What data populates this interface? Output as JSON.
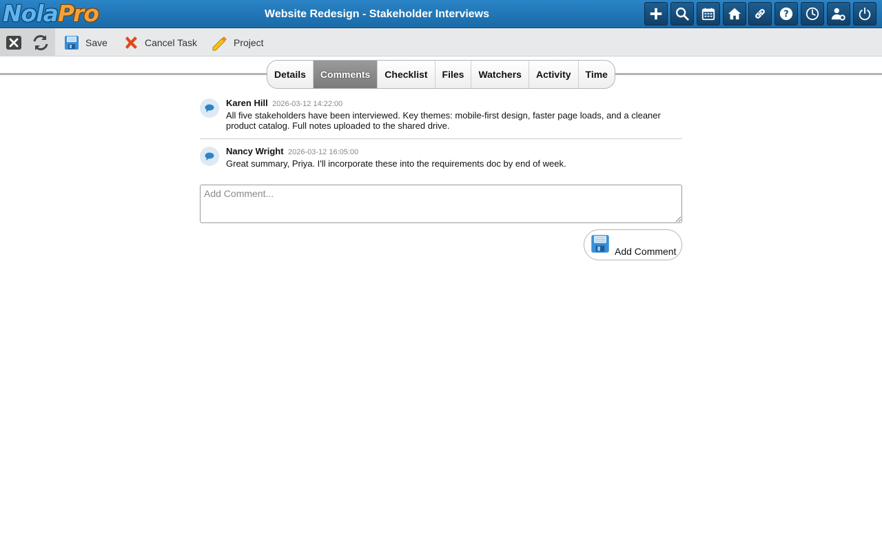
{
  "app": {
    "logo_part1": "Nola",
    "logo_part2": "Pro",
    "title": "Website Redesign - Stakeholder Interviews"
  },
  "header_icons": [
    "plus-icon",
    "search-icon",
    "calendar-icon",
    "home-icon",
    "link-icon",
    "help-icon",
    "clock-icon",
    "user-settings-icon",
    "power-icon"
  ],
  "toolbar": {
    "close_icon": "close-icon",
    "refresh_icon": "refresh-icon",
    "save_label": "Save",
    "cancel_label": "Cancel Task",
    "project_label": "Project"
  },
  "tabs": [
    {
      "label": "Details",
      "active": false
    },
    {
      "label": "Comments",
      "active": true
    },
    {
      "label": "Checklist",
      "active": false
    },
    {
      "label": "Files",
      "active": false
    },
    {
      "label": "Watchers",
      "active": false
    },
    {
      "label": "Activity",
      "active": false
    },
    {
      "label": "Time",
      "active": false
    }
  ],
  "comments": [
    {
      "author": "Karen Hill",
      "timestamp": "2026-03-12 14:22:00",
      "body": "All five stakeholders have been interviewed. Key themes: mobile-first design, faster page loads, and a cleaner product catalog. Full notes uploaded to the shared drive."
    },
    {
      "author": "Nancy Wright",
      "timestamp": "2026-03-12 16:05:00",
      "body": "Great summary, Priya. I'll incorporate these into the requirements doc by end of week."
    }
  ],
  "comment_input": {
    "placeholder": "Add Comment...",
    "value": ""
  },
  "add_comment_label": "Add Comment",
  "colors": {
    "header": "#1a6aa8",
    "accent": "#2a84c6",
    "tab_active": "#8a8a8a"
  }
}
